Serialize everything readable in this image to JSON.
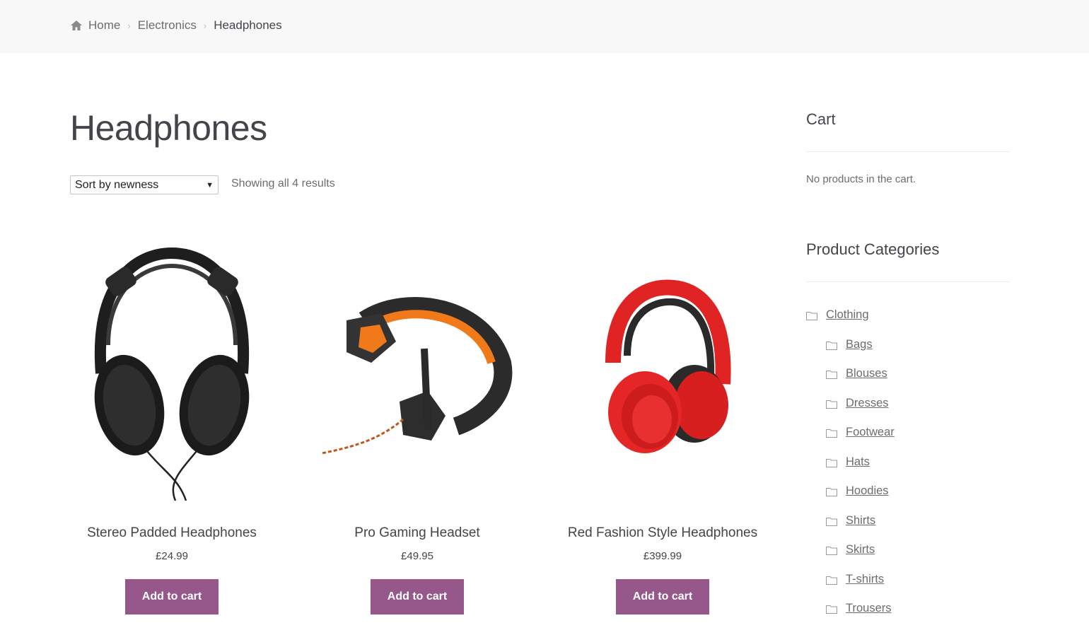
{
  "breadcrumb": {
    "icon": "home-icon",
    "items": [
      "Home",
      "Electronics",
      "Headphones"
    ]
  },
  "page_title": "Headphones",
  "sort": {
    "selected": "Sort by newness"
  },
  "result_count": "Showing all 4 results",
  "products": [
    {
      "name": "Stereo Padded Headphones",
      "price": "£24.99",
      "button": "Add to cart",
      "image": "black-studio-headphones"
    },
    {
      "name": "Pro Gaming Headset",
      "price": "£49.95",
      "button": "Add to cart",
      "image": "orange-gaming-headset"
    },
    {
      "name": "Red Fashion Style Headphones",
      "price": "£399.99",
      "button": "Add to cart",
      "image": "red-headphones"
    }
  ],
  "cart": {
    "title": "Cart",
    "empty_text": "No products in the cart."
  },
  "categories": {
    "title": "Product Categories",
    "items": [
      {
        "label": "Clothing",
        "level": 0
      },
      {
        "label": "Bags",
        "level": 1
      },
      {
        "label": "Blouses",
        "level": 1
      },
      {
        "label": "Dresses",
        "level": 1
      },
      {
        "label": "Footwear",
        "level": 1
      },
      {
        "label": "Hats",
        "level": 1
      },
      {
        "label": "Hoodies",
        "level": 1
      },
      {
        "label": "Shirts",
        "level": 1
      },
      {
        "label": "Skirts",
        "level": 1
      },
      {
        "label": "T-shirts",
        "level": 1
      },
      {
        "label": "Trousers",
        "level": 1
      }
    ]
  },
  "colors": {
    "accent": "#96588a",
    "breadcrumb_bg": "#f8f8f8"
  }
}
